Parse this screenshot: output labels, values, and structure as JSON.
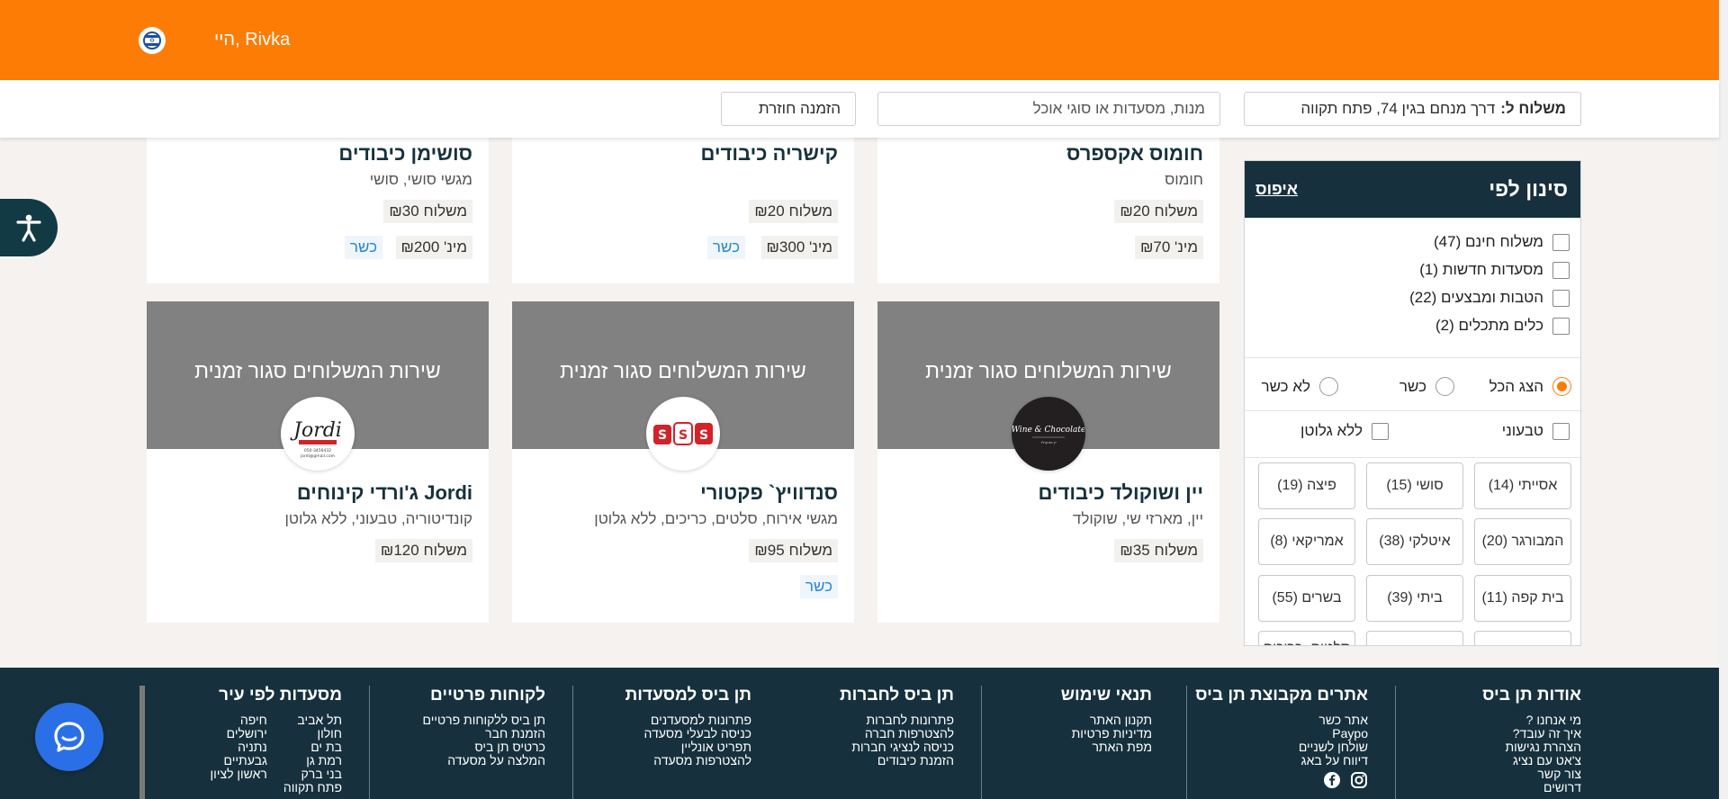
{
  "header": {
    "greeting": "היי, Rivka",
    "language_icon": "israel-flag-icon",
    "delivery_label": "משלוח ל:",
    "delivery_address": "דרך מנחם בגין 74, פתח תקווה",
    "search_placeholder": "מנות, מסעדות או סוגי אוכל",
    "reorder_label": "הזמנה חוזרת"
  },
  "colors": {
    "brand_orange": "#fd7c05",
    "navy": "#16313d",
    "closed_banner": "#818181",
    "kosher_blue": "#2686d6"
  },
  "top_cards": [
    {
      "title": "חומוס אקספרס",
      "subtitle": "חומוס",
      "delivery": "משלוח ₪20",
      "min": "מינ' ₪70",
      "kosher": ""
    },
    {
      "title": "קישריה כיבודים",
      "subtitle": "",
      "delivery": "משלוח ₪20",
      "min": "מינ' ₪300",
      "kosher": "כשר"
    },
    {
      "title": "סושימן כיבודים",
      "subtitle": "מגשי סושי, סושי",
      "delivery": "משלוח ₪30",
      "min": "מינ' ₪200",
      "kosher": "כשר"
    }
  ],
  "bottom_cards": [
    {
      "banner": "שירות המשלוחים סגור זמנית",
      "title": "יין ושוקולד כיבודים",
      "subtitle": "יין, מארזי שי, שוקולד",
      "delivery": "משלוח ₪35",
      "kosher": "",
      "logo_text": "Wine & Chocolate"
    },
    {
      "banner": "שירות המשלוחים סגור זמנית",
      "title": "סנדוויץ` פקטורי",
      "subtitle": "מגשי אירוח, סלטים, כריכים, ללא גלוטן",
      "delivery": "משלוח ₪95",
      "kosher": "כשר",
      "logo_text": "S"
    },
    {
      "banner": "שירות המשלוחים סגור זמנית",
      "title": "Jordi ג'ורדי קינוחים",
      "subtitle": "קונדיטוריה, טבעוני, ללא גלוטן",
      "delivery": "משלוח ₪120",
      "kosher": "",
      "logo_text": "Jordi"
    }
  ],
  "filter": {
    "title": "סינון לפי",
    "reset": "איפוס",
    "checkboxes": [
      "משלוח חינם (47)",
      "מסעדות חדשות (1)",
      "הטבות ומבצעים (22)",
      "כלים מתכלים (2)"
    ],
    "radios": [
      "הצג הכל",
      "כשר",
      "לא כשר"
    ],
    "diet": [
      "טבעוני",
      "ללא גלוטן"
    ],
    "chips": [
      "אסייתי (14)",
      "סושי (15)",
      "פיצה (19)",
      "המבורגר (20)",
      "איטלקי (38)",
      "אמריקאי (8)",
      "בית קפה (11)",
      "ביתי (39)",
      "בשרים (55)",
      "",
      "",
      "סלטים, כריכים"
    ]
  },
  "footer": {
    "columns": [
      {
        "title": "אודות תן ביס",
        "links": [
          "מי אנחנו ?",
          "איך זה עובד?",
          "הצהרת נגישות",
          "צ'אט עם נציג",
          "צור קשר",
          "דרושים"
        ]
      },
      {
        "title": "אתרים מקבוצת תן ביס",
        "links": [
          "אתר כשר",
          "Paypo",
          "שולחן לשניים",
          "דיווח על באג"
        ]
      },
      {
        "title": "תנאי שימוש",
        "links": [
          "תקנון האתר",
          "מדיניות פרטיות",
          "מפת האתר"
        ]
      },
      {
        "title": "תן ביס לחברות",
        "links": [
          "פתרונות לחברות",
          "להצטרפות חברה",
          "כניסה לנציגי חברות",
          "הזמנת כיבודים"
        ]
      },
      {
        "title": "תן ביס למסעדות",
        "links": [
          "פתרונות למסעדנים",
          "כניסה לבעלי מסעדה",
          "תפריט אונליין",
          "להצטרפות מסעדה"
        ]
      },
      {
        "title": "לקוחות פרטיים",
        "links": [
          "תן ביס ללקוחות פרטיים",
          "הזמנת חבר",
          "כרטיס תן ביס",
          "המלצה על מסעדה"
        ]
      }
    ],
    "cities_title": "מסעדות לפי עיר",
    "cities_col1": [
      "תל אביב",
      "חולון",
      "בת ים",
      "רמת גן",
      "בני ברק",
      "פתח תקווה"
    ],
    "cities_col2": [
      "חיפה",
      "ירושלים",
      "נתניה",
      "גבעתיים",
      "ראשון לציון"
    ]
  }
}
